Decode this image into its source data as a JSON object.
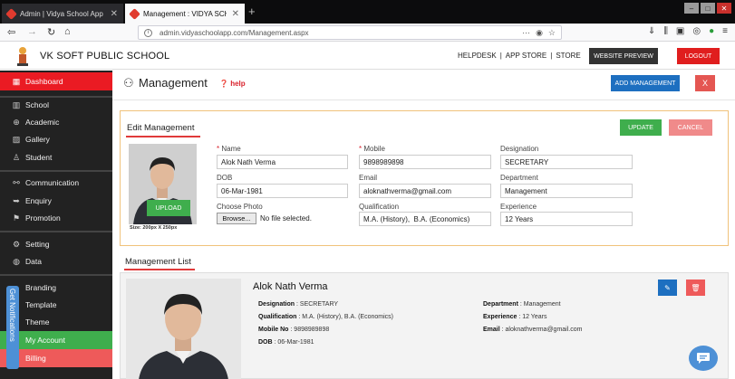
{
  "browser": {
    "tabs": [
      {
        "label": "Admin | Vidya School App | ɪ ɪ"
      },
      {
        "label": "Management : VIDYA SCHOOL"
      }
    ],
    "url": "admin.vidyaschoolapp.com/Management.aspx"
  },
  "header": {
    "school_name": "VK SOFT PUBLIC SCHOOL",
    "links": [
      "HELPDESK",
      "|",
      "APP STORE",
      "|",
      "STORE"
    ],
    "website_preview": "WEBSITE PREVIEW",
    "logout": "LOGOUT"
  },
  "sidebar": {
    "items": [
      {
        "label": "Dashboard",
        "icon": "grid-icon"
      },
      {
        "label": "School",
        "icon": "building-icon"
      },
      {
        "label": "Academic",
        "icon": "globe-icon"
      },
      {
        "label": "Gallery",
        "icon": "image-icon"
      },
      {
        "label": "Student",
        "icon": "person-icon"
      },
      {
        "label": "Communication",
        "icon": "link-icon"
      },
      {
        "label": "Enquiry",
        "icon": "arrow-icon"
      },
      {
        "label": "Promotion",
        "icon": "flag-icon"
      },
      {
        "label": "Setting",
        "icon": "gear-icon"
      },
      {
        "label": "Data",
        "icon": "database-icon"
      },
      {
        "label": "Branding"
      },
      {
        "label": "Template"
      },
      {
        "label": "Theme"
      },
      {
        "label": "My Account"
      },
      {
        "label": "Billing"
      }
    ],
    "notifications_tab": "Get Notifications"
  },
  "page": {
    "title": "Management",
    "help": "help",
    "add_button": "ADD MANAGEMENT",
    "close_button": "X"
  },
  "edit": {
    "title": "Edit Management",
    "update": "UPDATE",
    "cancel": "CANCEL",
    "upload": "UPLOAD",
    "size_note": "Size: 200px X 250px",
    "fields": {
      "name": {
        "label": "Name",
        "value": "Alok Nath Verma"
      },
      "mobile": {
        "label": "Mobile",
        "value": "9898989898"
      },
      "designation": {
        "label": "Designation",
        "value": "SECRETARY"
      },
      "dob": {
        "label": "DOB",
        "value": "06-Mar-1981"
      },
      "email": {
        "label": "Email",
        "value": "aloknathverma@gmail.com"
      },
      "department": {
        "label": "Department",
        "value": "Management"
      },
      "photo": {
        "label": "Choose Photo",
        "browse": "Browse...",
        "status": "No file selected."
      },
      "qualification": {
        "label": "Qualification",
        "value": "M.A. (History),  B.A. (Economics)"
      },
      "experience": {
        "label": "Experience",
        "value": "12 Years"
      }
    },
    "required_mark": "*"
  },
  "list": {
    "title": "Management List",
    "items": [
      {
        "name": "Alok Nath Verma",
        "designation_label": "Designation",
        "designation": ": SECRETARY",
        "qualification_label": "Qualification",
        "qualification": ": M.A. (History), B.A. (Economics)",
        "mobile_label": "Mobile No",
        "mobile": ": 9898989898",
        "dob_label": "DOB",
        "dob": ": 06-Mar-1981",
        "department_label": "Department",
        "department": ": Management",
        "experience_label": "Experience",
        "experience": ": 12 Years",
        "email_label": "Email",
        "email": ": aloknathverma@gmail.com"
      }
    ]
  },
  "colors": {
    "sidebar_bg": "#222222",
    "dashboard_active": "#ea1b23",
    "primary": "#1d6fc0",
    "success": "#3fae4d",
    "danger": "#e45652",
    "panel_border": "#f0c27b"
  }
}
